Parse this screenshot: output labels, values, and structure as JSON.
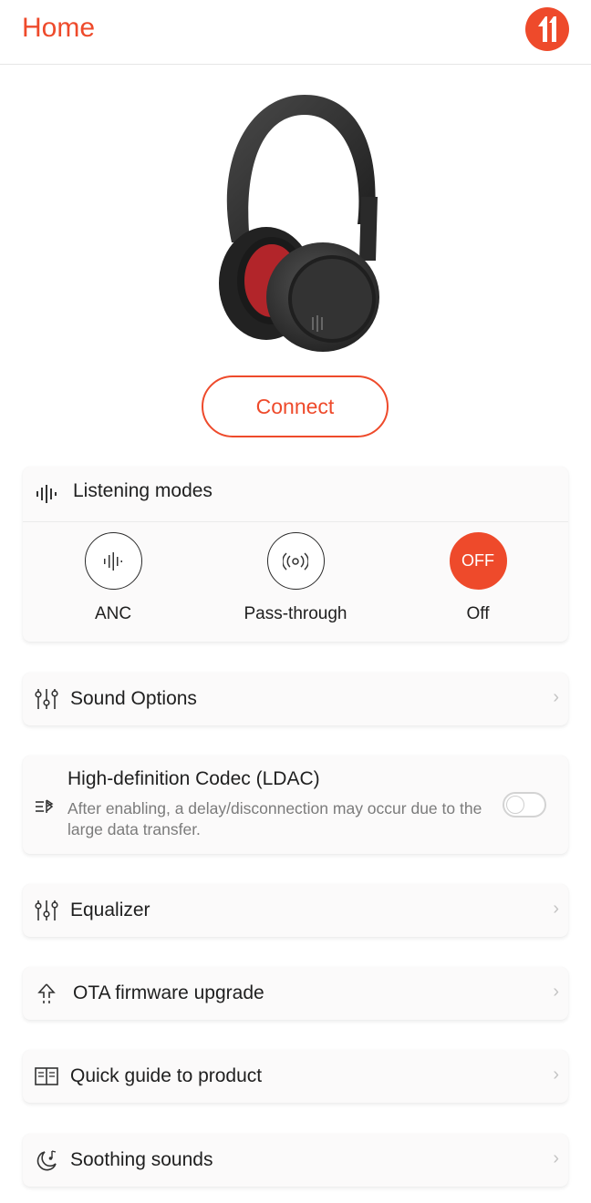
{
  "header": {
    "title": "Home",
    "logo_icon": "brand-logo-icon"
  },
  "product": {
    "image_icon": "headphones-image",
    "connect_label": "Connect"
  },
  "listening_modes": {
    "title": "Listening modes",
    "modes": [
      {
        "label": "ANC",
        "icon": "anc-waveform-icon"
      },
      {
        "label": "Pass-through",
        "icon": "pass-through-icon"
      },
      {
        "label": "Off",
        "badge": "OFF",
        "selected": true
      }
    ]
  },
  "menu": {
    "sound_options": "Sound Options",
    "ldac_title": "High-definition Codec (LDAC)",
    "ldac_desc": "After enabling, a delay/disconnection may occur due to the large data transfer.",
    "ldac_enabled": false,
    "equalizer": "Equalizer",
    "ota": "OTA firmware upgrade",
    "guide": "Quick guide to product",
    "soothing": "Soothing sounds"
  },
  "colors": {
    "accent": "#ee4a2b"
  }
}
